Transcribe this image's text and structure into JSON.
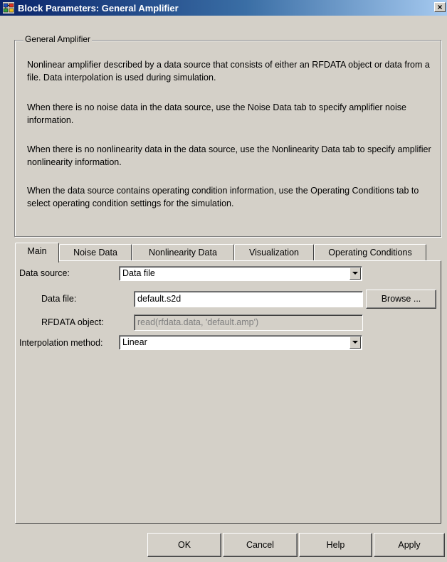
{
  "window": {
    "title": "Block Parameters: General Amplifier",
    "icon": "simulink-block-icon",
    "close_label": "×"
  },
  "group": {
    "legend": "General Amplifier",
    "description": [
      "Nonlinear amplifier described by a data source that consists of either an RFDATA object or data from a file. Data interpolation is used during simulation.",
      "When there is no noise data in the data source, use the Noise Data tab to specify amplifier noise information.",
      "When there is no nonlinearity data in the data source, use the Nonlinearity Data tab to specify amplifier nonlinearity information.",
      "When the data source contains operating condition information, use the Operating Conditions tab to select operating condition settings for the simulation."
    ]
  },
  "tabs": [
    {
      "label": "Main",
      "active": true
    },
    {
      "label": "Noise Data",
      "active": false
    },
    {
      "label": "Nonlinearity Data",
      "active": false
    },
    {
      "label": "Visualization",
      "active": false
    },
    {
      "label": "Operating Conditions",
      "active": false
    }
  ],
  "main": {
    "data_source": {
      "label": "Data source:",
      "value": "Data file"
    },
    "data_file": {
      "label": "Data file:",
      "value": "default.s2d",
      "browse_label": "Browse ..."
    },
    "rfdata_object": {
      "label": "RFDATA object:",
      "value": "read(rfdata.data, 'default.amp')",
      "enabled": false
    },
    "interpolation_method": {
      "label": "Interpolation method:",
      "value": "Linear"
    }
  },
  "buttons": {
    "ok": "OK",
    "cancel": "Cancel",
    "help": "Help",
    "apply": "Apply"
  },
  "colors": {
    "dialog_background": "#d4d0c8",
    "titlebar_start": "#0a246a",
    "titlebar_end": "#a6caf0",
    "disabled_text": "#808080"
  }
}
